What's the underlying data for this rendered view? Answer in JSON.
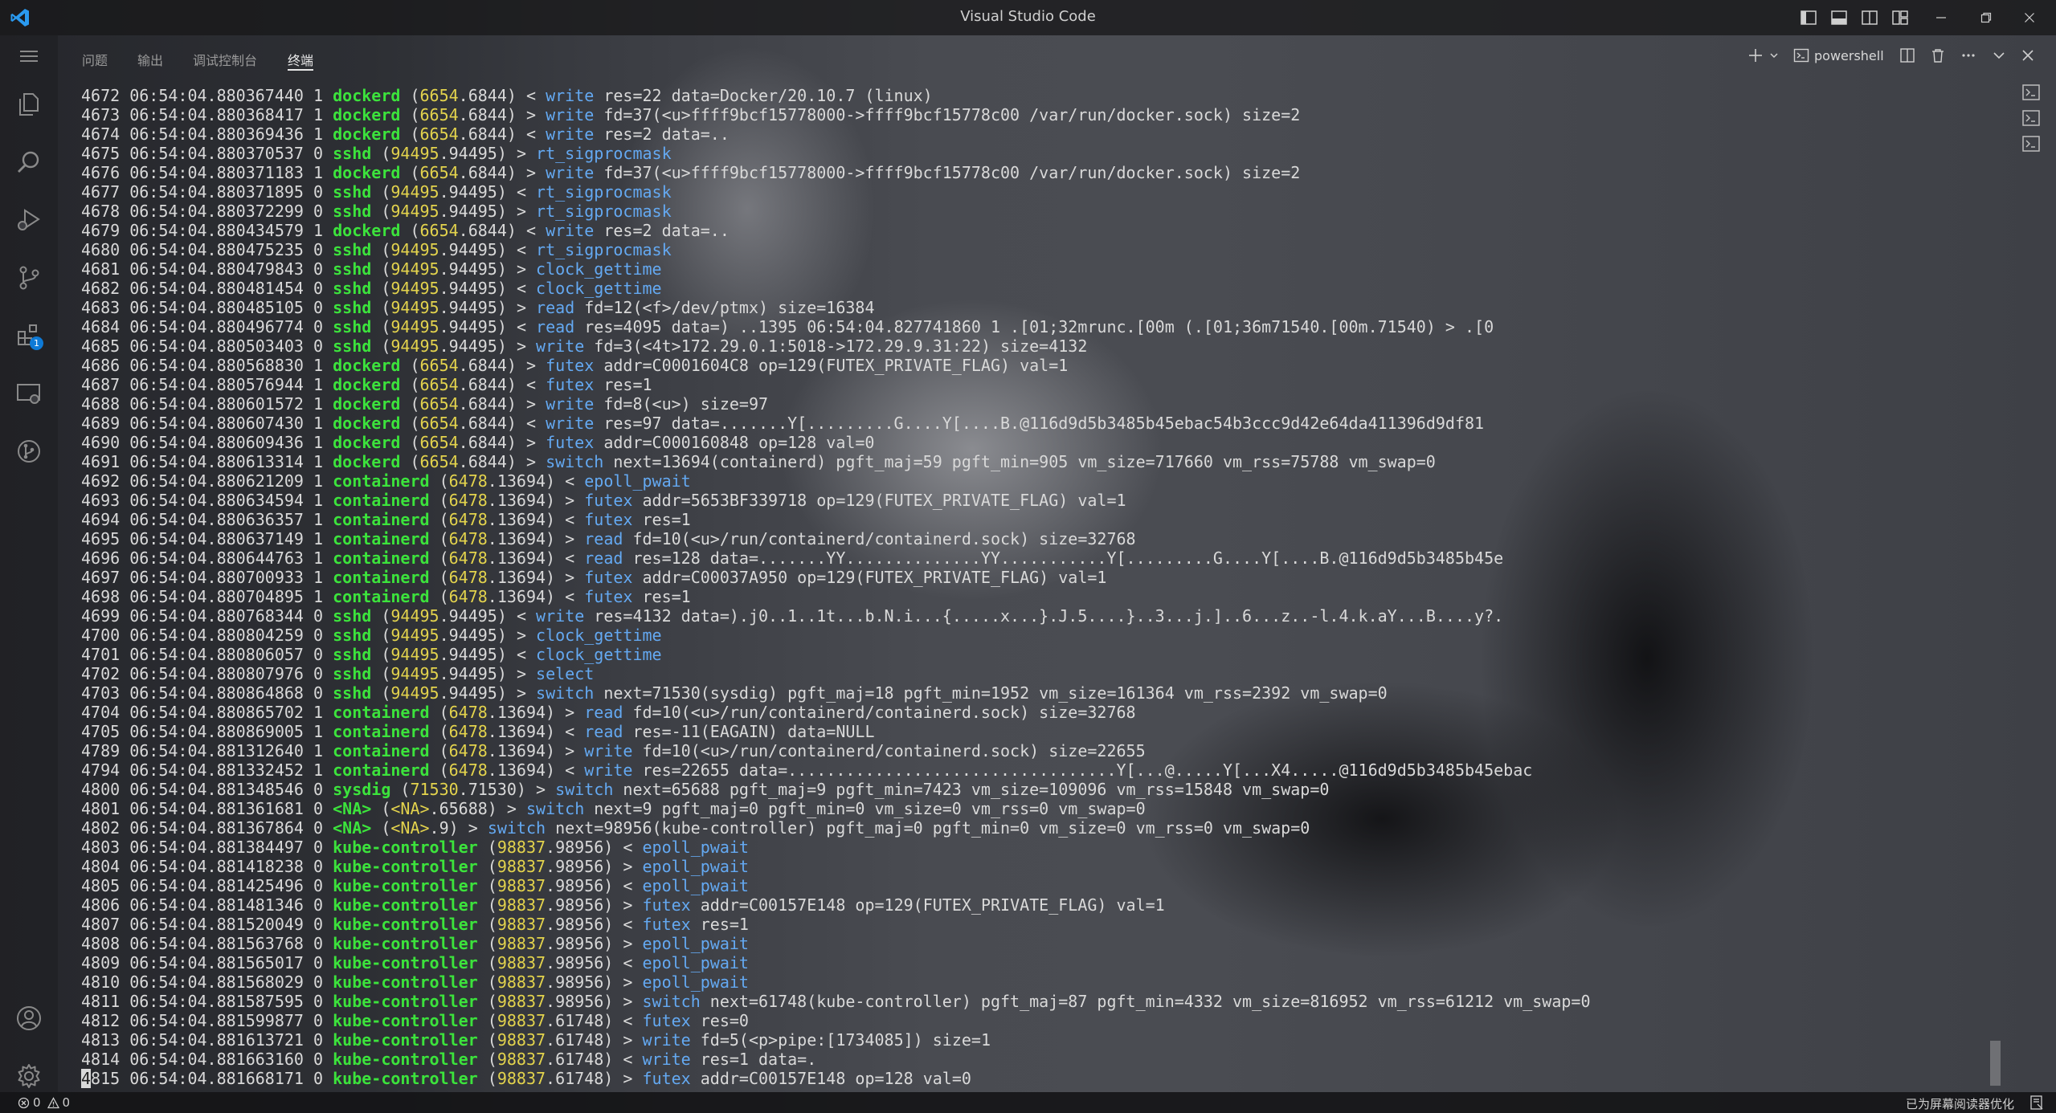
{
  "window": {
    "title": "Visual Studio Code"
  },
  "panel": {
    "tabs": [
      {
        "label": "问题",
        "active": false
      },
      {
        "label": "输出",
        "active": false
      },
      {
        "label": "调试控制台",
        "active": false
      },
      {
        "label": "终端",
        "active": true
      }
    ],
    "terminal_name": "powershell"
  },
  "activity": {
    "extensions_badge": "1"
  },
  "terminal": {
    "lines": [
      {
        "num": "4672",
        "ts": "06:54:04.880367440",
        "cpu": "1",
        "comm": "dockerd",
        "tidA": "6654",
        "tidB": ".6844)",
        "dir": "<",
        "ev": "write",
        "args": "res=22 data=Docker/20.10.7 (linux)"
      },
      {
        "num": "4673",
        "ts": "06:54:04.880368417",
        "cpu": "1",
        "comm": "dockerd",
        "tidA": "6654",
        "tidB": ".6844)",
        "dir": ">",
        "ev": "write",
        "args": "fd=37(<u>ffff9bcf15778000->ffff9bcf15778c00 /var/run/docker.sock) size=2"
      },
      {
        "num": "4674",
        "ts": "06:54:04.880369436",
        "cpu": "1",
        "comm": "dockerd",
        "tidA": "6654",
        "tidB": ".6844)",
        "dir": "<",
        "ev": "write",
        "args": "res=2 data=.."
      },
      {
        "num": "4675",
        "ts": "06:54:04.880370537",
        "cpu": "0",
        "comm": "sshd",
        "tidA": "94495",
        "tidB": ".94495)",
        "dir": ">",
        "ev": "rt_sigprocmask",
        "args": ""
      },
      {
        "num": "4676",
        "ts": "06:54:04.880371183",
        "cpu": "1",
        "comm": "dockerd",
        "tidA": "6654",
        "tidB": ".6844)",
        "dir": ">",
        "ev": "write",
        "args": "fd=37(<u>ffff9bcf15778000->ffff9bcf15778c00 /var/run/docker.sock) size=2"
      },
      {
        "num": "4677",
        "ts": "06:54:04.880371895",
        "cpu": "0",
        "comm": "sshd",
        "tidA": "94495",
        "tidB": ".94495)",
        "dir": "<",
        "ev": "rt_sigprocmask",
        "args": ""
      },
      {
        "num": "4678",
        "ts": "06:54:04.880372299",
        "cpu": "0",
        "comm": "sshd",
        "tidA": "94495",
        "tidB": ".94495)",
        "dir": ">",
        "ev": "rt_sigprocmask",
        "args": ""
      },
      {
        "num": "4679",
        "ts": "06:54:04.880434579",
        "cpu": "1",
        "comm": "dockerd",
        "tidA": "6654",
        "tidB": ".6844)",
        "dir": "<",
        "ev": "write",
        "args": "res=2 data=.."
      },
      {
        "num": "4680",
        "ts": "06:54:04.880475235",
        "cpu": "0",
        "comm": "sshd",
        "tidA": "94495",
        "tidB": ".94495)",
        "dir": "<",
        "ev": "rt_sigprocmask",
        "args": ""
      },
      {
        "num": "4681",
        "ts": "06:54:04.880479843",
        "cpu": "0",
        "comm": "sshd",
        "tidA": "94495",
        "tidB": ".94495)",
        "dir": ">",
        "ev": "clock_gettime",
        "args": ""
      },
      {
        "num": "4682",
        "ts": "06:54:04.880481454",
        "cpu": "0",
        "comm": "sshd",
        "tidA": "94495",
        "tidB": ".94495)",
        "dir": "<",
        "ev": "clock_gettime",
        "args": ""
      },
      {
        "num": "4683",
        "ts": "06:54:04.880485105",
        "cpu": "0",
        "comm": "sshd",
        "tidA": "94495",
        "tidB": ".94495)",
        "dir": ">",
        "ev": "read",
        "args": "fd=12(<f>/dev/ptmx) size=16384"
      },
      {
        "num": "4684",
        "ts": "06:54:04.880496774",
        "cpu": "0",
        "comm": "sshd",
        "tidA": "94495",
        "tidB": ".94495)",
        "dir": "<",
        "ev": "read",
        "args": "res=4095 data=) ..1395 06:54:04.827741860 1 .[01;32mrunc.[00m (.[01;36m71540.[00m.71540) > .[0"
      },
      {
        "num": "4685",
        "ts": "06:54:04.880503403",
        "cpu": "0",
        "comm": "sshd",
        "tidA": "94495",
        "tidB": ".94495)",
        "dir": ">",
        "ev": "write",
        "args": "fd=3(<4t>172.29.0.1:5018->172.29.9.31:22) size=4132"
      },
      {
        "num": "4686",
        "ts": "06:54:04.880568830",
        "cpu": "1",
        "comm": "dockerd",
        "tidA": "6654",
        "tidB": ".6844)",
        "dir": ">",
        "ev": "futex",
        "args": "addr=C0001604C8 op=129(FUTEX_PRIVATE_FLAG) val=1"
      },
      {
        "num": "4687",
        "ts": "06:54:04.880576944",
        "cpu": "1",
        "comm": "dockerd",
        "tidA": "6654",
        "tidB": ".6844)",
        "dir": "<",
        "ev": "futex",
        "args": "res=1"
      },
      {
        "num": "4688",
        "ts": "06:54:04.880601572",
        "cpu": "1",
        "comm": "dockerd",
        "tidA": "6654",
        "tidB": ".6844)",
        "dir": ">",
        "ev": "write",
        "args": "fd=8(<u>) size=97"
      },
      {
        "num": "4689",
        "ts": "06:54:04.880607430",
        "cpu": "1",
        "comm": "dockerd",
        "tidA": "6654",
        "tidB": ".6844)",
        "dir": "<",
        "ev": "write",
        "args": "res=97 data=.......Y[.........G....Y[....B.@116d9d5b3485b45ebac54b3ccc9d42e64da411396d9df81"
      },
      {
        "num": "4690",
        "ts": "06:54:04.880609436",
        "cpu": "1",
        "comm": "dockerd",
        "tidA": "6654",
        "tidB": ".6844)",
        "dir": ">",
        "ev": "futex",
        "args": "addr=C000160848 op=128 val=0"
      },
      {
        "num": "4691",
        "ts": "06:54:04.880613314",
        "cpu": "1",
        "comm": "dockerd",
        "tidA": "6654",
        "tidB": ".6844)",
        "dir": ">",
        "ev": "switch",
        "args": "next=13694(containerd) pgft_maj=59 pgft_min=905 vm_size=717660 vm_rss=75788 vm_swap=0"
      },
      {
        "num": "4692",
        "ts": "06:54:04.880621209",
        "cpu": "1",
        "comm": "containerd",
        "tidA": "6478",
        "tidB": ".13694)",
        "dir": "<",
        "ev": "epoll_pwait",
        "args": ""
      },
      {
        "num": "4693",
        "ts": "06:54:04.880634594",
        "cpu": "1",
        "comm": "containerd",
        "tidA": "6478",
        "tidB": ".13694)",
        "dir": ">",
        "ev": "futex",
        "args": "addr=5653BF339718 op=129(FUTEX_PRIVATE_FLAG) val=1"
      },
      {
        "num": "4694",
        "ts": "06:54:04.880636357",
        "cpu": "1",
        "comm": "containerd",
        "tidA": "6478",
        "tidB": ".13694)",
        "dir": "<",
        "ev": "futex",
        "args": "res=1"
      },
      {
        "num": "4695",
        "ts": "06:54:04.880637149",
        "cpu": "1",
        "comm": "containerd",
        "tidA": "6478",
        "tidB": ".13694)",
        "dir": ">",
        "ev": "read",
        "args": "fd=10(<u>/run/containerd/containerd.sock) size=32768"
      },
      {
        "num": "4696",
        "ts": "06:54:04.880644763",
        "cpu": "1",
        "comm": "containerd",
        "tidA": "6478",
        "tidB": ".13694)",
        "dir": "<",
        "ev": "read",
        "args": "res=128 data=.......YY..............YY...........Y[.........G....Y[....B.@116d9d5b3485b45e"
      },
      {
        "num": "4697",
        "ts": "06:54:04.880700933",
        "cpu": "1",
        "comm": "containerd",
        "tidA": "6478",
        "tidB": ".13694)",
        "dir": ">",
        "ev": "futex",
        "args": "addr=C00037A950 op=129(FUTEX_PRIVATE_FLAG) val=1"
      },
      {
        "num": "4698",
        "ts": "06:54:04.880704895",
        "cpu": "1",
        "comm": "containerd",
        "tidA": "6478",
        "tidB": ".13694)",
        "dir": "<",
        "ev": "futex",
        "args": "res=1"
      },
      {
        "num": "4699",
        "ts": "06:54:04.880768344",
        "cpu": "0",
        "comm": "sshd",
        "tidA": "94495",
        "tidB": ".94495)",
        "dir": "<",
        "ev": "write",
        "args": "res=4132 data=).j0..1..1t...b.N.i...{.....x...}.J.5....}..3...j.]..6...z..-l.4.k.aY...B....y?."
      },
      {
        "num": "4700",
        "ts": "06:54:04.880804259",
        "cpu": "0",
        "comm": "sshd",
        "tidA": "94495",
        "tidB": ".94495)",
        "dir": ">",
        "ev": "clock_gettime",
        "args": ""
      },
      {
        "num": "4701",
        "ts": "06:54:04.880806057",
        "cpu": "0",
        "comm": "sshd",
        "tidA": "94495",
        "tidB": ".94495)",
        "dir": "<",
        "ev": "clock_gettime",
        "args": ""
      },
      {
        "num": "4702",
        "ts": "06:54:04.880807976",
        "cpu": "0",
        "comm": "sshd",
        "tidA": "94495",
        "tidB": ".94495)",
        "dir": ">",
        "ev": "select",
        "args": ""
      },
      {
        "num": "4703",
        "ts": "06:54:04.880864868",
        "cpu": "0",
        "comm": "sshd",
        "tidA": "94495",
        "tidB": ".94495)",
        "dir": ">",
        "ev": "switch",
        "args": "next=71530(sysdig) pgft_maj=18 pgft_min=1952 vm_size=161364 vm_rss=2392 vm_swap=0"
      },
      {
        "num": "4704",
        "ts": "06:54:04.880865702",
        "cpu": "1",
        "comm": "containerd",
        "tidA": "6478",
        "tidB": ".13694)",
        "dir": ">",
        "ev": "read",
        "args": "fd=10(<u>/run/containerd/containerd.sock) size=32768"
      },
      {
        "num": "4705",
        "ts": "06:54:04.880869005",
        "cpu": "1",
        "comm": "containerd",
        "tidA": "6478",
        "tidB": ".13694)",
        "dir": "<",
        "ev": "read",
        "args": "res=-11(EAGAIN) data=NULL"
      },
      {
        "num": "4789",
        "ts": "06:54:04.881312640",
        "cpu": "1",
        "comm": "containerd",
        "tidA": "6478",
        "tidB": ".13694)",
        "dir": ">",
        "ev": "write",
        "args": "fd=10(<u>/run/containerd/containerd.sock) size=22655"
      },
      {
        "num": "4794",
        "ts": "06:54:04.881332452",
        "cpu": "1",
        "comm": "containerd",
        "tidA": "6478",
        "tidB": ".13694)",
        "dir": "<",
        "ev": "write",
        "args": "res=22655 data=..................................Y[...@.....Y[...X4.....@116d9d5b3485b45ebac"
      },
      {
        "num": "4800",
        "ts": "06:54:04.881348546",
        "cpu": "0",
        "comm": "sysdig",
        "tidA": "71530",
        "tidB": ".71530)",
        "dir": ">",
        "ev": "switch",
        "args": "next=65688 pgft_maj=9 pgft_min=7423 vm_size=109096 vm_rss=15848 vm_swap=0"
      },
      {
        "num": "4801",
        "ts": "06:54:04.881361681",
        "cpu": "0",
        "comm": "<NA>",
        "tidA": "<NA>",
        "tidB": ".65688)",
        "dir": ">",
        "ev": "switch",
        "args": "next=9 pgft_maj=0 pgft_min=0 vm_size=0 vm_rss=0 vm_swap=0"
      },
      {
        "num": "4802",
        "ts": "06:54:04.881367864",
        "cpu": "0",
        "comm": "<NA>",
        "tidA": "<NA>",
        "tidB": ".9)",
        "dir": ">",
        "ev": "switch",
        "args": "next=98956(kube-controller) pgft_maj=0 pgft_min=0 vm_size=0 vm_rss=0 vm_swap=0"
      },
      {
        "num": "4803",
        "ts": "06:54:04.881384497",
        "cpu": "0",
        "comm": "kube-controller",
        "tidA": "98837",
        "tidB": ".98956)",
        "dir": "<",
        "ev": "epoll_pwait",
        "args": ""
      },
      {
        "num": "4804",
        "ts": "06:54:04.881418238",
        "cpu": "0",
        "comm": "kube-controller",
        "tidA": "98837",
        "tidB": ".98956)",
        "dir": ">",
        "ev": "epoll_pwait",
        "args": ""
      },
      {
        "num": "4805",
        "ts": "06:54:04.881425496",
        "cpu": "0",
        "comm": "kube-controller",
        "tidA": "98837",
        "tidB": ".98956)",
        "dir": "<",
        "ev": "epoll_pwait",
        "args": ""
      },
      {
        "num": "4806",
        "ts": "06:54:04.881481346",
        "cpu": "0",
        "comm": "kube-controller",
        "tidA": "98837",
        "tidB": ".98956)",
        "dir": ">",
        "ev": "futex",
        "args": "addr=C00157E148 op=129(FUTEX_PRIVATE_FLAG) val=1"
      },
      {
        "num": "4807",
        "ts": "06:54:04.881520049",
        "cpu": "0",
        "comm": "kube-controller",
        "tidA": "98837",
        "tidB": ".98956)",
        "dir": "<",
        "ev": "futex",
        "args": "res=1"
      },
      {
        "num": "4808",
        "ts": "06:54:04.881563768",
        "cpu": "0",
        "comm": "kube-controller",
        "tidA": "98837",
        "tidB": ".98956)",
        "dir": ">",
        "ev": "epoll_pwait",
        "args": ""
      },
      {
        "num": "4809",
        "ts": "06:54:04.881565017",
        "cpu": "0",
        "comm": "kube-controller",
        "tidA": "98837",
        "tidB": ".98956)",
        "dir": "<",
        "ev": "epoll_pwait",
        "args": ""
      },
      {
        "num": "4810",
        "ts": "06:54:04.881568029",
        "cpu": "0",
        "comm": "kube-controller",
        "tidA": "98837",
        "tidB": ".98956)",
        "dir": ">",
        "ev": "epoll_pwait",
        "args": ""
      },
      {
        "num": "4811",
        "ts": "06:54:04.881587595",
        "cpu": "0",
        "comm": "kube-controller",
        "tidA": "98837",
        "tidB": ".98956)",
        "dir": ">",
        "ev": "switch",
        "args": "next=61748(kube-controller) pgft_maj=87 pgft_min=4332 vm_size=816952 vm_rss=61212 vm_swap=0"
      },
      {
        "num": "4812",
        "ts": "06:54:04.881599877",
        "cpu": "0",
        "comm": "kube-controller",
        "tidA": "98837",
        "tidB": ".61748)",
        "dir": "<",
        "ev": "futex",
        "args": "res=0"
      },
      {
        "num": "4813",
        "ts": "06:54:04.881613721",
        "cpu": "0",
        "comm": "kube-controller",
        "tidA": "98837",
        "tidB": ".61748)",
        "dir": ">",
        "ev": "write",
        "args": "fd=5(<p>pipe:[1734085]) size=1"
      },
      {
        "num": "4814",
        "ts": "06:54:04.881663160",
        "cpu": "0",
        "comm": "kube-controller",
        "tidA": "98837",
        "tidB": ".61748)",
        "dir": "<",
        "ev": "write",
        "args": "res=1 data=."
      }
    ],
    "last_line": {
      "cursor_char": "4",
      "rest_num": "815",
      "ts": "06:54:04.881668171",
      "cpu": "0",
      "comm": "kube-controller",
      "tidA": "98837",
      "tidB": ".61748)",
      "dir": ">",
      "ev": "futex",
      "args": "addr=C00157E148 op=128 val=0"
    }
  },
  "statusbar": {
    "errors": "0",
    "warnings": "0",
    "screen_reader": "已为屏幕阅读器优化"
  }
}
